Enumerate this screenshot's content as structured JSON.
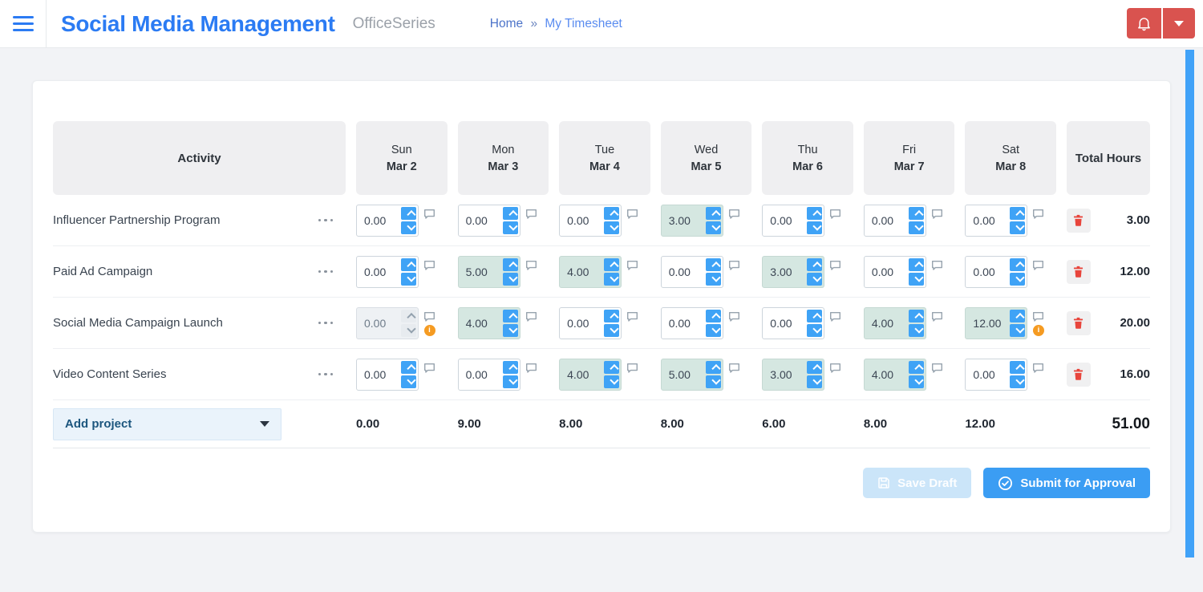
{
  "header": {
    "app_title": "Social Media Management",
    "brand": "OfficeSeries",
    "breadcrumb": {
      "home": "Home",
      "separator": "»",
      "current": "My Timesheet"
    }
  },
  "icons": {
    "warning_glyph": "i"
  },
  "colors": {
    "accent_blue": "#2b7bf3",
    "spinner_blue": "#3fa3f6",
    "danger_red": "#d9534f",
    "filled_teal": "#d5e7e1",
    "warning_orange": "#f59b22",
    "scrollbar_blue": "#41a2f8"
  },
  "timesheet": {
    "header": {
      "activity": "Activity",
      "days": [
        {
          "day": "Sun",
          "date": "Mar 2"
        },
        {
          "day": "Mon",
          "date": "Mar 3"
        },
        {
          "day": "Tue",
          "date": "Mar 4"
        },
        {
          "day": "Wed",
          "date": "Mar 5"
        },
        {
          "day": "Thu",
          "date": "Mar 6"
        },
        {
          "day": "Fri",
          "date": "Mar 7"
        },
        {
          "day": "Sat",
          "date": "Mar 8"
        }
      ],
      "total": "Total Hours"
    },
    "rows": [
      {
        "activity": "Influencer Partnership Program",
        "cells": [
          {
            "value": "0.00",
            "state": "normal",
            "warning": false
          },
          {
            "value": "0.00",
            "state": "normal",
            "warning": false
          },
          {
            "value": "0.00",
            "state": "normal",
            "warning": false
          },
          {
            "value": "3.00",
            "state": "filled",
            "warning": false
          },
          {
            "value": "0.00",
            "state": "normal",
            "warning": false
          },
          {
            "value": "0.00",
            "state": "normal",
            "warning": false
          },
          {
            "value": "0.00",
            "state": "normal",
            "warning": false
          }
        ],
        "total": "3.00"
      },
      {
        "activity": "Paid Ad Campaign",
        "cells": [
          {
            "value": "0.00",
            "state": "normal",
            "warning": false
          },
          {
            "value": "5.00",
            "state": "filled",
            "warning": false
          },
          {
            "value": "4.00",
            "state": "filled",
            "warning": false
          },
          {
            "value": "0.00",
            "state": "normal",
            "warning": false
          },
          {
            "value": "3.00",
            "state": "filled",
            "warning": false
          },
          {
            "value": "0.00",
            "state": "normal",
            "warning": false
          },
          {
            "value": "0.00",
            "state": "normal",
            "warning": false
          }
        ],
        "total": "12.00"
      },
      {
        "activity": "Social Media Campaign Launch",
        "cells": [
          {
            "value": "0.00",
            "state": "disabled",
            "warning": true
          },
          {
            "value": "4.00",
            "state": "filled",
            "warning": false
          },
          {
            "value": "0.00",
            "state": "normal",
            "warning": false
          },
          {
            "value": "0.00",
            "state": "normal",
            "warning": false
          },
          {
            "value": "0.00",
            "state": "normal",
            "warning": false
          },
          {
            "value": "4.00",
            "state": "filled",
            "warning": false
          },
          {
            "value": "12.00",
            "state": "filled",
            "warning": true
          }
        ],
        "total": "20.00"
      },
      {
        "activity": "Video Content Series",
        "cells": [
          {
            "value": "0.00",
            "state": "normal",
            "warning": false
          },
          {
            "value": "0.00",
            "state": "normal",
            "warning": false
          },
          {
            "value": "4.00",
            "state": "filled",
            "warning": false
          },
          {
            "value": "5.00",
            "state": "filled",
            "warning": false
          },
          {
            "value": "3.00",
            "state": "filled",
            "warning": false
          },
          {
            "value": "4.00",
            "state": "filled",
            "warning": false
          },
          {
            "value": "0.00",
            "state": "normal",
            "warning": false
          }
        ],
        "total": "16.00"
      }
    ],
    "footer": {
      "add_project": "Add project",
      "day_totals": [
        "0.00",
        "9.00",
        "8.00",
        "8.00",
        "6.00",
        "8.00",
        "12.00"
      ],
      "grand_total": "51.00"
    },
    "actions": {
      "save_draft": "Save Draft",
      "submit": "Submit for Approval"
    }
  }
}
